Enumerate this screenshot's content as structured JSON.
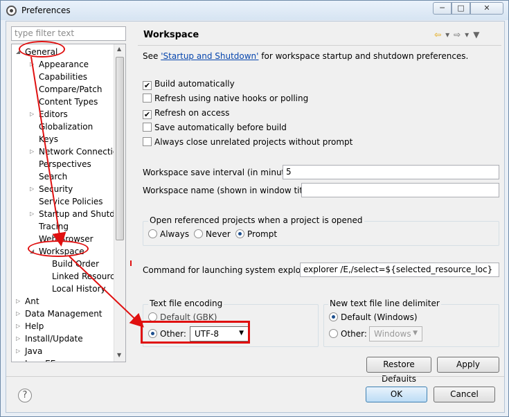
{
  "window": {
    "title": "Preferences",
    "controls": {
      "minimize": "─",
      "maximize": "□",
      "close": "✕"
    }
  },
  "filter": {
    "placeholder": "type filter text"
  },
  "tree": {
    "items": [
      {
        "label": "General",
        "level": 0,
        "expanded": true
      },
      {
        "label": "Appearance",
        "level": 1,
        "expandable": true
      },
      {
        "label": "Capabilities",
        "level": 1
      },
      {
        "label": "Compare/Patch",
        "level": 1
      },
      {
        "label": "Content Types",
        "level": 1
      },
      {
        "label": "Editors",
        "level": 1,
        "expandable": true
      },
      {
        "label": "Globalization",
        "level": 1
      },
      {
        "label": "Keys",
        "level": 1
      },
      {
        "label": "Network Connection",
        "level": 1,
        "expandable": true
      },
      {
        "label": "Perspectives",
        "level": 1
      },
      {
        "label": "Search",
        "level": 1
      },
      {
        "label": "Security",
        "level": 1,
        "expandable": true
      },
      {
        "label": "Service Policies",
        "level": 1
      },
      {
        "label": "Startup and Shutdow",
        "level": 1,
        "expandable": true
      },
      {
        "label": "Tracing",
        "level": 1
      },
      {
        "label": "Web Browser",
        "level": 1
      },
      {
        "label": "Workspace",
        "level": 1,
        "expanded": true,
        "selected": true
      },
      {
        "label": "Build Order",
        "level": 2
      },
      {
        "label": "Linked Resource",
        "level": 2
      },
      {
        "label": "Local History",
        "level": 2
      },
      {
        "label": "Ant",
        "level": 0,
        "expandable": true
      },
      {
        "label": "Data Management",
        "level": 0,
        "expandable": true
      },
      {
        "label": "Help",
        "level": 0,
        "expandable": true
      },
      {
        "label": "Install/Update",
        "level": 0,
        "expandable": true
      },
      {
        "label": "Java",
        "level": 0,
        "expandable": true
      },
      {
        "label": "Java EE",
        "level": 0,
        "expandable": true
      }
    ]
  },
  "panel": {
    "title": "Workspace",
    "desc_prefix": "See ",
    "desc_link": "'Startup and Shutdown'",
    "desc_suffix": " for workspace startup and shutdown preferences."
  },
  "checkboxes": [
    {
      "label": "Build automatically",
      "checked": true
    },
    {
      "label": "Refresh using native hooks or polling",
      "checked": false
    },
    {
      "label": "Refresh on access",
      "checked": true
    },
    {
      "label": "Save automatically before build",
      "checked": false
    },
    {
      "label": "Always close unrelated projects without prompt",
      "checked": false
    }
  ],
  "fields": {
    "save_interval_label": "Workspace save interval (in minutes):",
    "save_interval_value": "5",
    "ws_name_label": "Workspace name (shown in window title):",
    "ws_name_value": "",
    "explorer_label": "Command for launching system explorer:",
    "explorer_value": "explorer /E,/select=${selected_resource_loc}"
  },
  "open_projects": {
    "label": "Open referenced projects when a project is opened",
    "options": [
      "Always",
      "Never",
      "Prompt"
    ],
    "selected": "Prompt"
  },
  "encoding": {
    "label": "Text file encoding",
    "default_label": "Default (GBK)",
    "other_label": "Other:",
    "other_value": "UTF-8",
    "selected": "Other"
  },
  "delimiter": {
    "label": "New text file line delimiter",
    "default_label": "Default (Windows)",
    "other_label": "Other:",
    "other_value": "Windows",
    "selected": "Default"
  },
  "buttons": {
    "restore": "Restore Defaults",
    "apply": "Apply",
    "ok": "OK",
    "cancel": "Cancel",
    "help": "?"
  },
  "colors": {
    "annotation": "#e01010",
    "link": "#0645ad",
    "selected_radio": "#1d4f8e"
  }
}
